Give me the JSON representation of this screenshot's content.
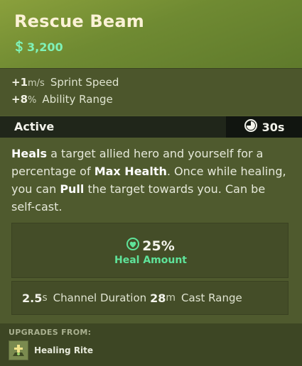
{
  "item": {
    "title": "Rescue Beam",
    "cost": "3,200"
  },
  "stats": [
    {
      "value": "+1",
      "unit": "m/s",
      "label": "Sprint Speed"
    },
    {
      "value": "+8",
      "unit": "%",
      "label": "Ability Range"
    }
  ],
  "active": {
    "label": "Active",
    "cooldown": "30s"
  },
  "description": {
    "p1_bold": "Heals",
    "p2": " a target allied hero and yourself for a percentage of ",
    "p3_bold": "Max Health",
    "p4": ". Once while healing, you can ",
    "p5_bold": "Pull",
    "p6": " the target towards you. Can be self-cast."
  },
  "heal": {
    "value": "25%",
    "label": "Heal Amount"
  },
  "channel": {
    "duration_value": "2.5",
    "duration_unit": "s",
    "duration_label": "Channel Duration",
    "range_value": "28",
    "range_unit": "m",
    "range_label": "Cast Range"
  },
  "upgrades": {
    "title": "UPGRADES FROM:",
    "items": [
      {
        "name": "Healing Rite",
        "icon": "healing-rite-icon"
      }
    ]
  },
  "colors": {
    "header": "#7a9434",
    "soul_cost": "#7ff2b8",
    "heal_label": "#5fe39a"
  }
}
